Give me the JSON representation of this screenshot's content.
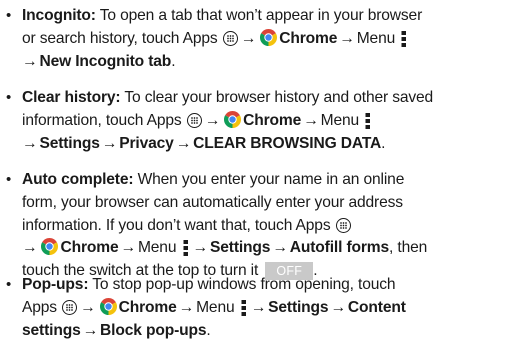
{
  "icons": {
    "apps": "apps-icon",
    "chrome": "chrome-icon",
    "menu": "menu-icon",
    "arrow": "→"
  },
  "colors": {
    "text": "#1a1a1a",
    "toggle_bg": "#c9c9c9",
    "chrome_red": "#db4437",
    "chrome_yellow": "#f4c20d",
    "chrome_green": "#0f9d58",
    "chrome_blue": "#4285f4"
  },
  "tips": {
    "bullet": "•",
    "incognito": {
      "title": "Incognito:",
      "l1_text": " To open a tab that won’t appear in your browser",
      "l2_text": "or search history, touch Apps ",
      "chrome": "Chrome",
      "menu": "Menu",
      "new_tab": "New Incognito tab",
      "period": "."
    },
    "clear": {
      "title": "Clear history:",
      "l1_text": " To clear your browser history and other saved",
      "l2_text": "information, touch Apps ",
      "chrome": "Chrome",
      "menu": "Menu",
      "settings": "Settings",
      "privacy": "Privacy",
      "clear_data": "CLEAR BROWSING DATA",
      "period": "."
    },
    "autocomplete": {
      "title": "Auto complete:",
      "l1_text": " When you enter your name in an online",
      "l2_text": "form, your browser can automatically enter your address",
      "l3_text": "information. If you don’t want that, touch Apps ",
      "chrome": "Chrome",
      "menu": "Menu",
      "settings": "Settings",
      "autofill": "Autofill forms",
      "then": ", then",
      "l5_text": "touch the switch at the top to turn it ",
      "toggle": "OFF",
      "period": "."
    },
    "popups": {
      "title": "Pop-ups:",
      "l1_text": " To stop pop-up windows from opening, touch",
      "apps": "Apps ",
      "chrome": "Chrome",
      "menu": "Menu",
      "settings": "Settings",
      "content": "Content",
      "content_settings": "settings",
      "block": "Block pop-ups",
      "period": "."
    }
  }
}
